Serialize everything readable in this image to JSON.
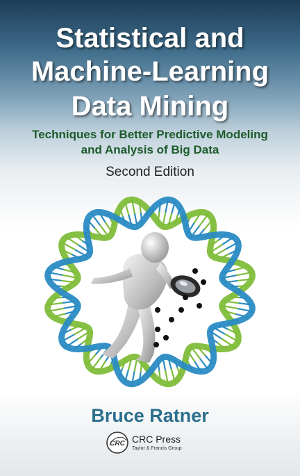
{
  "title_lines": [
    "Statistical and",
    "Machine-Learning",
    "Data Mining"
  ],
  "subtitle_lines": [
    "Techniques for Better Predictive Modeling",
    "and Analysis of Big Data"
  ],
  "edition": "Second Edition",
  "author": "Bruce Ratner",
  "publisher": {
    "logo_text": "CRC",
    "name": "CRC Press",
    "group": "Taylor & Francis Group"
  },
  "colors": {
    "title": "#ffffff",
    "subtitle": "#1d5a2b",
    "author": "#2b6f8d",
    "helix_blue": "#2a8bc3",
    "helix_green": "#7fbd3a"
  },
  "icons": [
    "dna-helix-ring",
    "figure-with-magnifying-glass",
    "data-dots"
  ]
}
